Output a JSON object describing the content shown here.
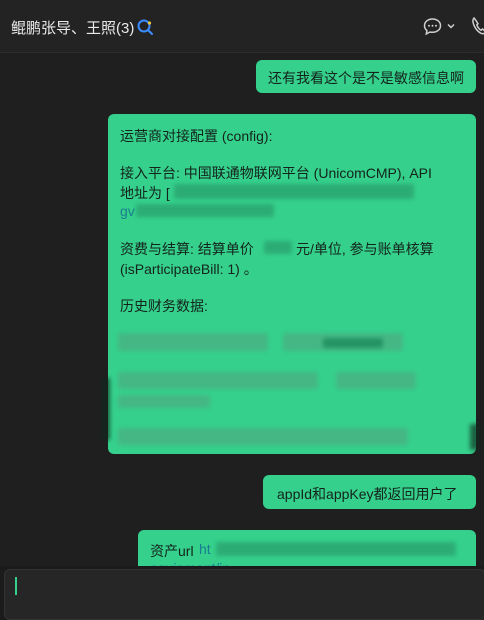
{
  "header": {
    "title": "鲲鹏张导、王照(3)"
  },
  "messages": {
    "m1": "还有我看这个是不是敏感信息啊",
    "m2": {
      "heading": "运营商对接配置 (config):",
      "access_line": "接入平台: 中国联通物联网平台 (UnicomCMP), API",
      "address_label": "地址为 [",
      "address_cont": "gv",
      "billing_line1_prefix": "资费与结算: 结算单价",
      "billing_line1_suffix": "元/单位, 参与账单核算",
      "billing_line2": "(isParticipateBill: 1) 。",
      "history_heading": "历史财务数据:"
    },
    "m3": "appId和appKey都返回用户了",
    "m4": {
      "prefix": "资产url",
      "link_start": "ht",
      "link_cont": "equipment/in"
    }
  }
}
